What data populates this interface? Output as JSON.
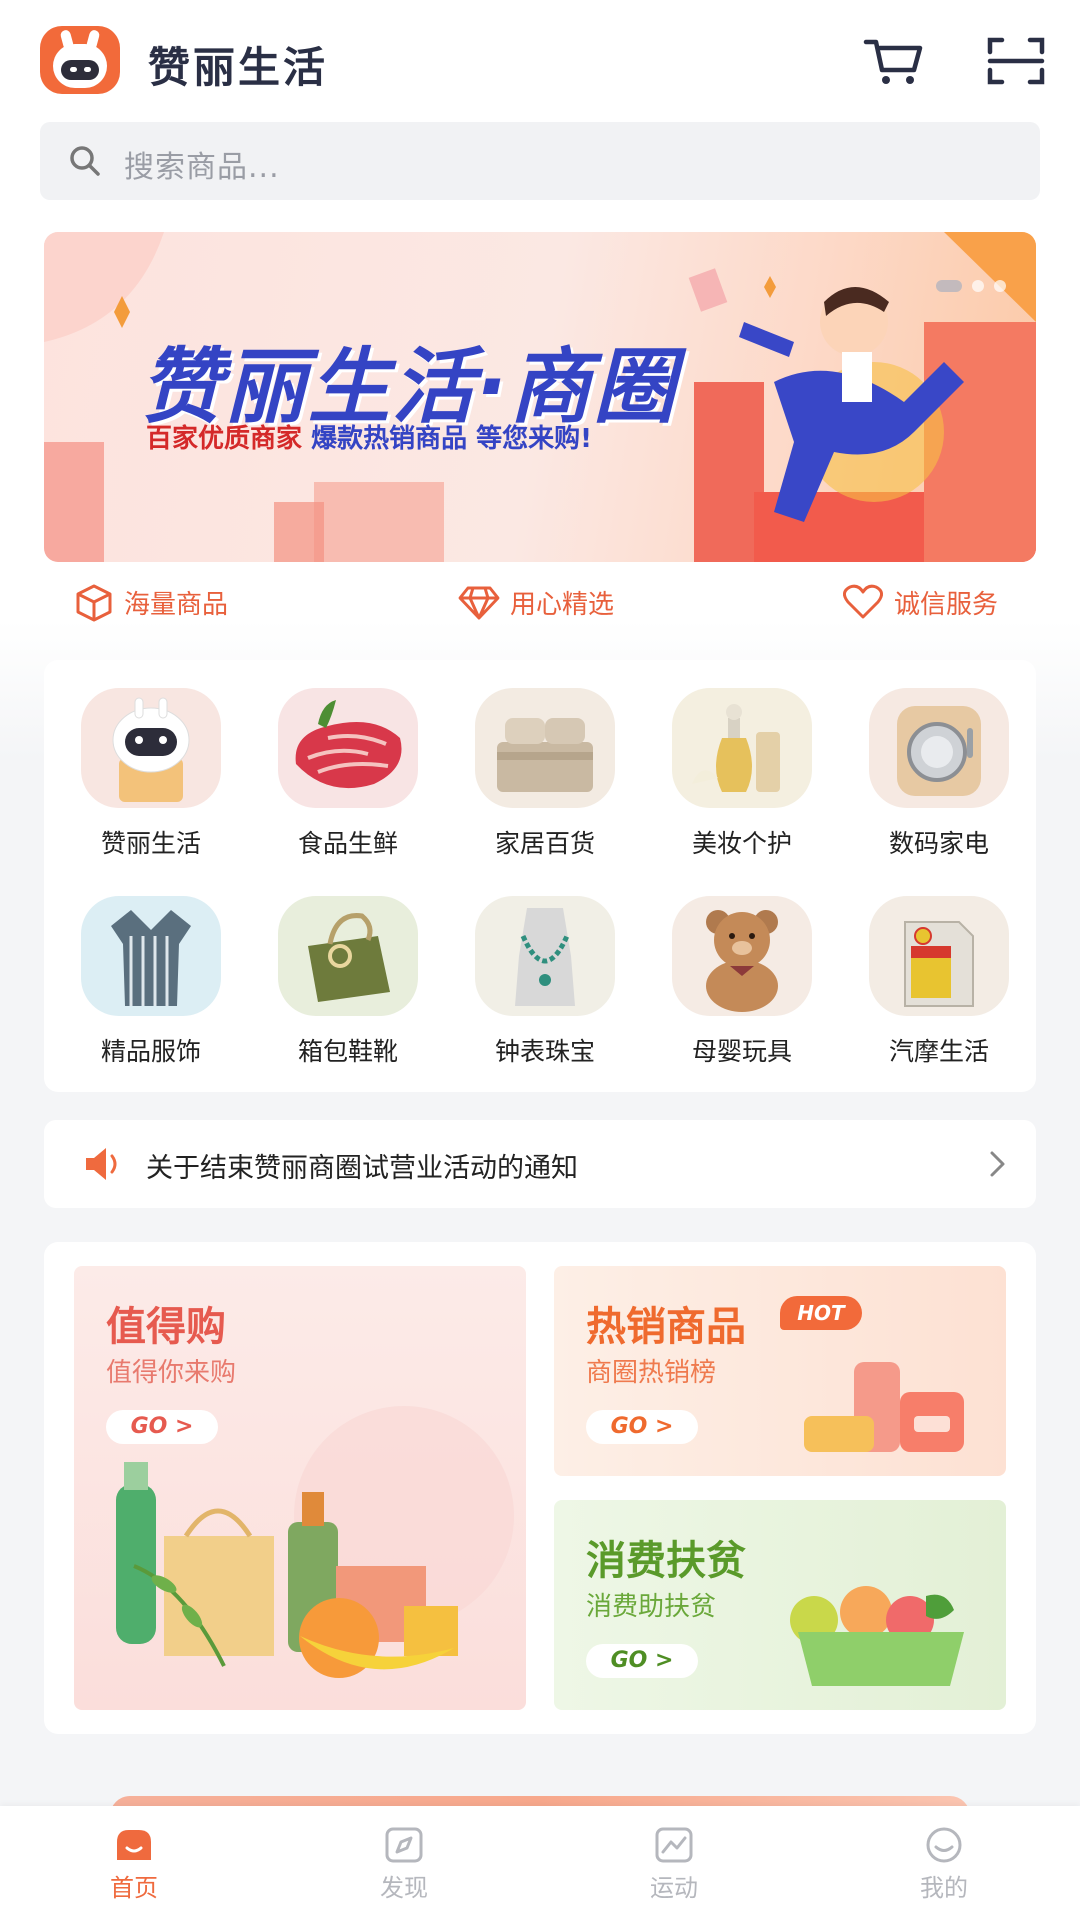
{
  "header": {
    "app_title": "赞丽生活",
    "cart_icon": "cart-icon",
    "scan_icon": "scan-icon"
  },
  "search": {
    "placeholder": "搜索商品..."
  },
  "banner": {
    "title": "赞丽生活·商圈",
    "subtitle_parts": [
      "百家优质商家",
      "爆款热销商品",
      "等您来购!"
    ],
    "page_indicator": {
      "count": 3,
      "active_index": 0
    }
  },
  "features": [
    {
      "icon": "box-icon",
      "label": "海量商品"
    },
    {
      "icon": "diamond-icon",
      "label": "用心精选"
    },
    {
      "icon": "heart-icon",
      "label": "诚信服务"
    }
  ],
  "categories": [
    {
      "label": "赞丽生活",
      "icon": "robot-mascot-icon"
    },
    {
      "label": "食品生鲜",
      "icon": "meat-icon"
    },
    {
      "label": "家居百货",
      "icon": "bedding-icon"
    },
    {
      "label": "美妆个护",
      "icon": "perfume-icon"
    },
    {
      "label": "数码家电",
      "icon": "washing-machine-icon"
    },
    {
      "label": "精品服饰",
      "icon": "dress-icon"
    },
    {
      "label": "箱包鞋靴",
      "icon": "handbag-icon"
    },
    {
      "label": "钟表珠宝",
      "icon": "necklace-icon"
    },
    {
      "label": "母婴玩具",
      "icon": "teddy-bear-icon"
    },
    {
      "label": "汽摩生活",
      "icon": "motor-oil-icon"
    }
  ],
  "notice": {
    "text": "关于结束赞丽商圈试营业活动的通知"
  },
  "promos": {
    "worth": {
      "title": "值得购",
      "subtitle": "值得你来购",
      "go": "GO >"
    },
    "hot": {
      "title": "热销商品",
      "badge": "HOT",
      "subtitle": "商圈热销榜",
      "go": "GO >"
    },
    "poverty": {
      "title": "消费扶贫",
      "subtitle": "消费助扶贫",
      "go": "GO >"
    }
  },
  "tabbar": [
    {
      "label": "首页",
      "icon": "home-icon",
      "active": true
    },
    {
      "label": "发现",
      "icon": "compass-icon",
      "active": false
    },
    {
      "label": "运动",
      "icon": "chart-icon",
      "active": false
    },
    {
      "label": "我的",
      "icon": "smile-icon",
      "active": false
    }
  ],
  "colors": {
    "accent": "#ef6a3e",
    "banner_title": "#3444c4",
    "worth_title": "#e65a4f",
    "hot_title": "#ef6a2e",
    "poverty_title": "#5a9a2a"
  }
}
